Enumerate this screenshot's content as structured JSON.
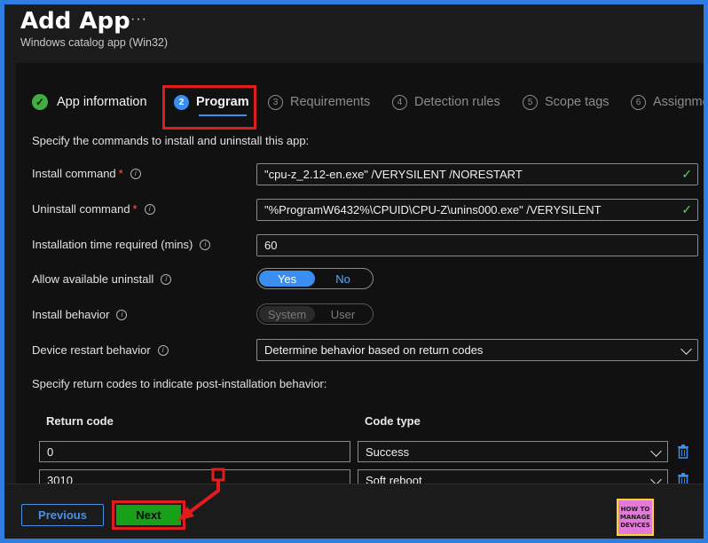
{
  "header": {
    "title": "Add App",
    "more_label": "···",
    "subtitle": "Windows catalog app (Win32)"
  },
  "tabs": [
    {
      "number": "",
      "label": "App information",
      "state": "done"
    },
    {
      "number": "2",
      "label": "Program",
      "state": "active"
    },
    {
      "number": "3",
      "label": "Requirements",
      "state": "pending"
    },
    {
      "number": "4",
      "label": "Detection rules",
      "state": "pending"
    },
    {
      "number": "5",
      "label": "Scope tags",
      "state": "pending"
    },
    {
      "number": "6",
      "label": "Assignme",
      "state": "pending"
    }
  ],
  "form": {
    "lead": "Specify the commands to install and uninstall this app:",
    "install_command": {
      "label": "Install command",
      "required": "*",
      "value": "\"cpu-z_2.12-en.exe\" /VERYSILENT /NORESTART"
    },
    "uninstall_command": {
      "label": "Uninstall command",
      "required": "*",
      "value": "\"%ProgramW6432%\\CPUID\\CPU-Z\\unins000.exe\" /VERYSILENT"
    },
    "install_time": {
      "label": "Installation time required (mins)",
      "value": "60"
    },
    "allow_uninstall": {
      "label": "Allow available uninstall",
      "options": [
        "Yes",
        "No"
      ],
      "selected": "Yes"
    },
    "install_behavior": {
      "label": "Install behavior",
      "options": [
        "System",
        "User"
      ],
      "selected": "System"
    },
    "restart_behavior": {
      "label": "Device restart behavior",
      "value": "Determine behavior based on return codes"
    },
    "return_codes_lead": "Specify return codes to indicate post-installation behavior:"
  },
  "return_codes": {
    "headers": {
      "code": "Return code",
      "type": "Code type"
    },
    "rows": [
      {
        "code": "0",
        "type": "Success"
      },
      {
        "code": "3010",
        "type": "Soft reboot"
      }
    ]
  },
  "footer": {
    "previous_label": "Previous",
    "next_label": "Next",
    "logo_text": "HOW TO MANAGE DEVICES"
  },
  "colors": {
    "accent": "#3a8ef0",
    "highlight": "#e01d1d",
    "next_button": "#19a019",
    "success": "#3fae3f"
  }
}
